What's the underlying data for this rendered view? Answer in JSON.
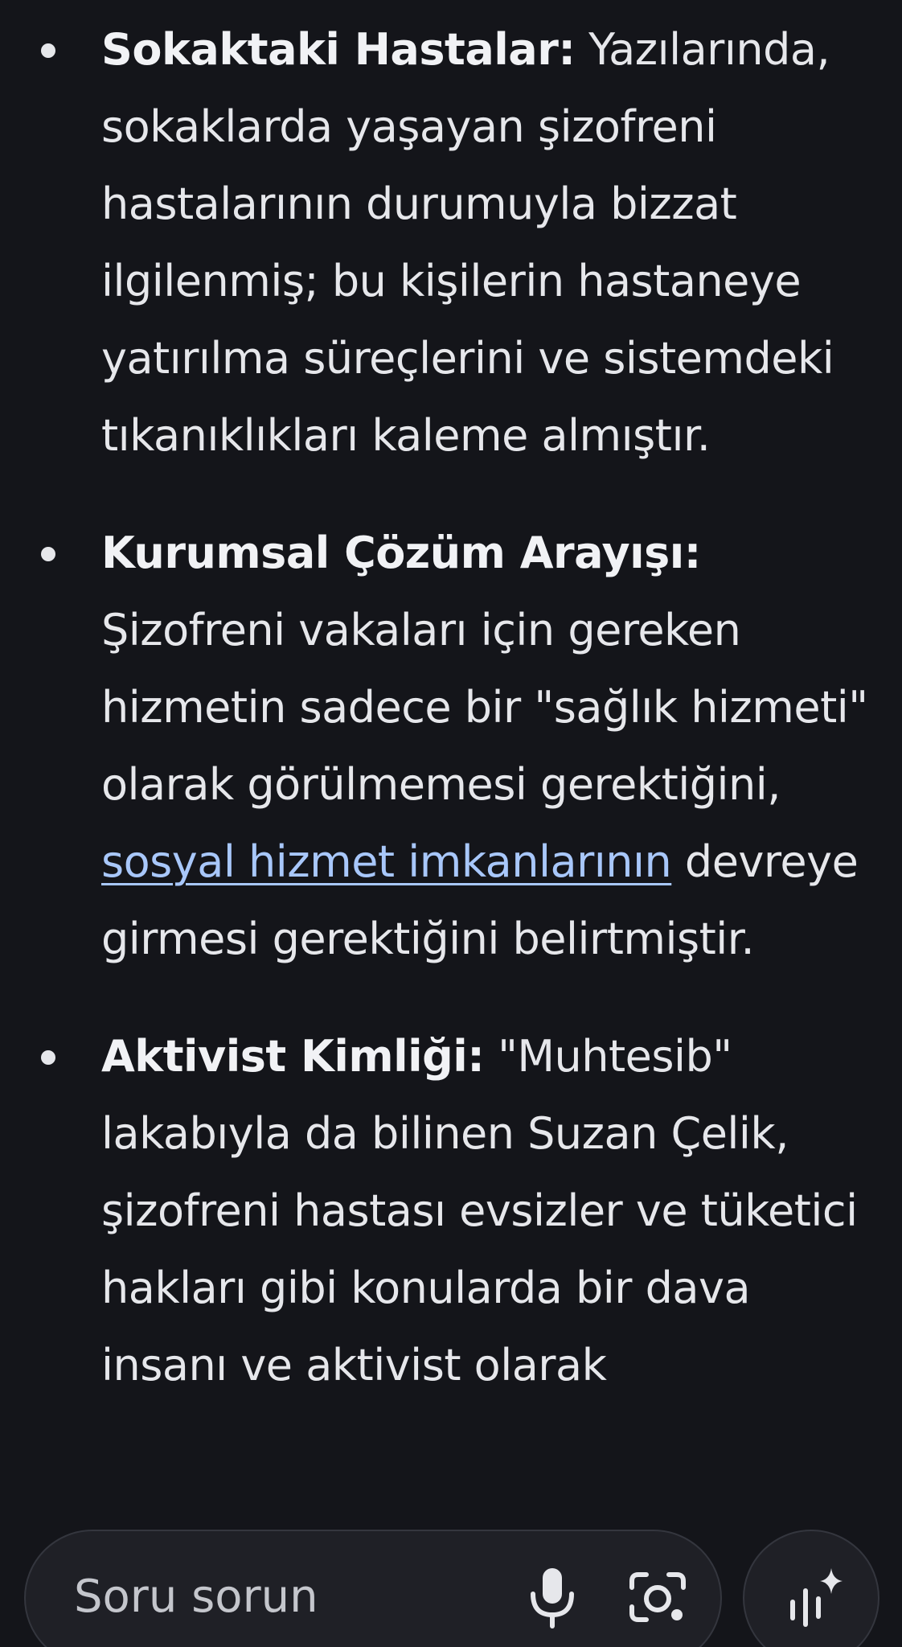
{
  "items": [
    {
      "title": "Sokaktaki Hastalar:",
      "text": " Yazılarında, sokaklarda yaşayan şizofreni hastalarının durumuyla bizzat ilgilenmiş; bu kişilerin hastaneye yatırılma süreçlerini ve sistemdeki tıkanıklıkları kaleme almıştır."
    },
    {
      "title": "Kurumsal Çözüm Arayışı:",
      "text_before": " Şizofreni vakaları için gereken hizmetin sadece bir \"sağlık hizmeti\" olarak görülmemesi gerektiğini, ",
      "link": "sosyal hizmet imkanlarının",
      "text_after": " devreye girmesi gerektiğini belirtmiştir."
    },
    {
      "title": "Aktivist Kimliği:",
      "text": " \"Muhtesib\" lakabıyla da bilinen Suzan Çelik, şizofreni hastası evsizler ve tüketici hakları gibi konularda bir dava insanı ve aktivist olarak"
    }
  ],
  "input": {
    "placeholder": "Soru sorun"
  },
  "icons": {
    "mic": "mic-icon",
    "lens": "lens-camera-icon",
    "mode": "sparkle-mode-icon"
  },
  "colors": {
    "background": "#14151a",
    "text": "#e6e7eb",
    "link": "#a8c7fa",
    "input_background": "#1f2026"
  }
}
